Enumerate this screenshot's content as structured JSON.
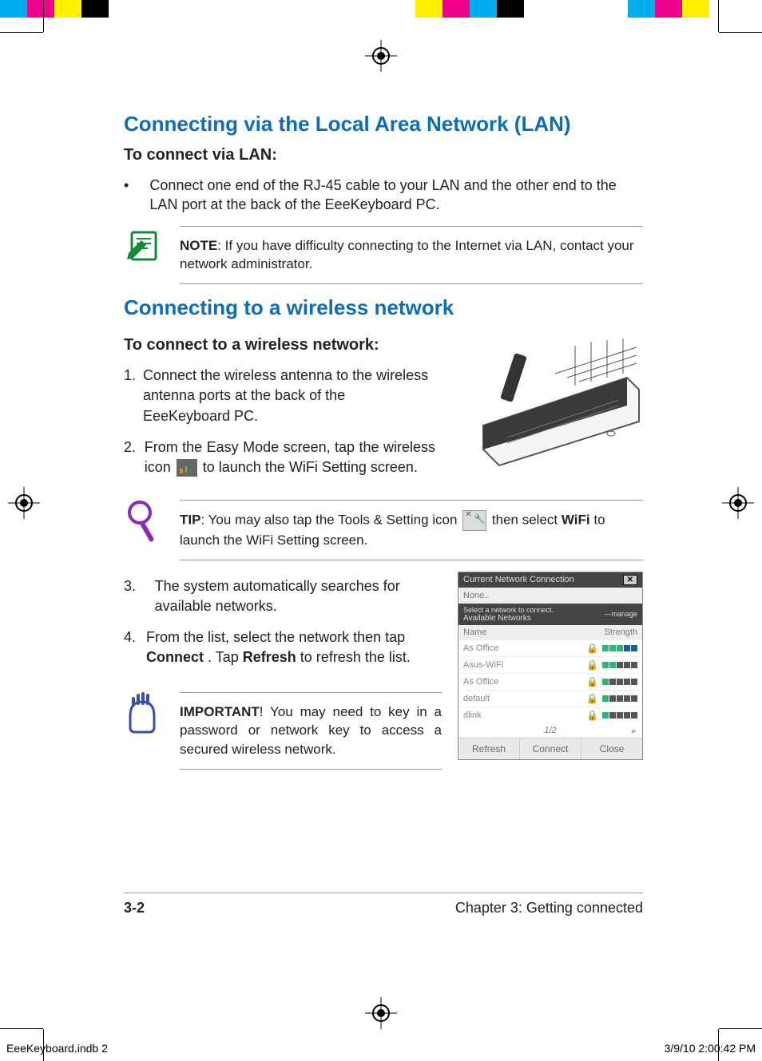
{
  "colorbar": [
    "#00adef",
    "#ed008c",
    "#fff100",
    "#000000",
    "#ffffff",
    "#ffffff",
    "#ffffff",
    "#ffffff",
    "#ffffff",
    "#ffffff",
    "#ffffff",
    "#ffffff",
    "#fff100",
    "#ed008c",
    "#00adef",
    "#000000",
    "#ffffff",
    "#00adef",
    "#ed008c",
    "#fff100"
  ],
  "heading_lan": "Connecting via the Local Area Network (LAN)",
  "sub_lan": "To connect via LAN:",
  "bullet_lan": "Connect one end of the RJ-45 cable to your LAN and the other end to the LAN port at the back of the EeeKeyboard PC.",
  "note_label": "NOTE",
  "note_text": ":  If you have difficulty connecting to the Internet via LAN, contact your network administrator.",
  "heading_wifi": "Connecting to a wireless network",
  "sub_wifi": "To connect to a wireless network:",
  "step1": "Connect the wireless antenna to the wireless antenna ports at the back of the EeeKeyboard PC.",
  "step2_a": "From the Easy Mode screen, tap the wireless icon ",
  "step2_b": " to launch the WiFi Setting screen.",
  "tip_label": "TIP",
  "tip_a": ":     You may also tap the Tools & Setting icon ",
  "tip_b": " then select ",
  "tip_bold": "WiFi",
  "tip_c": " to launch the WiFi Setting screen.",
  "step3": "The system automatically searches for available networks.",
  "step4_a": "From the list, select the network then tap ",
  "step4_b1": "Connect",
  "step4_c": ".  Tap ",
  "step4_b2": "Refresh",
  "step4_d": " to refresh the list.",
  "imp_label": "IMPORTANT",
  "imp_text": "!     You may need to key in a password or network key to access a secured wireless network.",
  "footer_page": "3-2",
  "footer_chapter": "Chapter 3: Getting connected",
  "slug_left": "EeeKeyboard.indb   2",
  "slug_right": "3/9/10   2:00:42 PM",
  "wifi_panel": {
    "title": "Current Network Connection",
    "status": "None..",
    "sub_a": "Select a network to connect.",
    "sub_b": "Available Networks",
    "manage": "—manage",
    "col_name": "Name",
    "col_strength": "Strength",
    "rows": [
      {
        "name": "As Office",
        "sig": [
          "g",
          "g",
          "g",
          "b",
          "b"
        ]
      },
      {
        "name": "Asus-WiFi",
        "sig": [
          "g",
          "g",
          "e",
          "e",
          "e"
        ]
      },
      {
        "name": "As Office",
        "sig": [
          "g",
          "e",
          "e",
          "e",
          "e"
        ]
      },
      {
        "name": "default",
        "sig": [
          "g",
          "e",
          "e",
          "e",
          "e"
        ]
      },
      {
        "name": "dlink",
        "sig": [
          "g",
          "e",
          "e",
          "e",
          "e"
        ]
      }
    ],
    "pager": "1/2",
    "btn_refresh": "Refresh",
    "btn_connect": "Connect",
    "btn_close": "Close"
  }
}
